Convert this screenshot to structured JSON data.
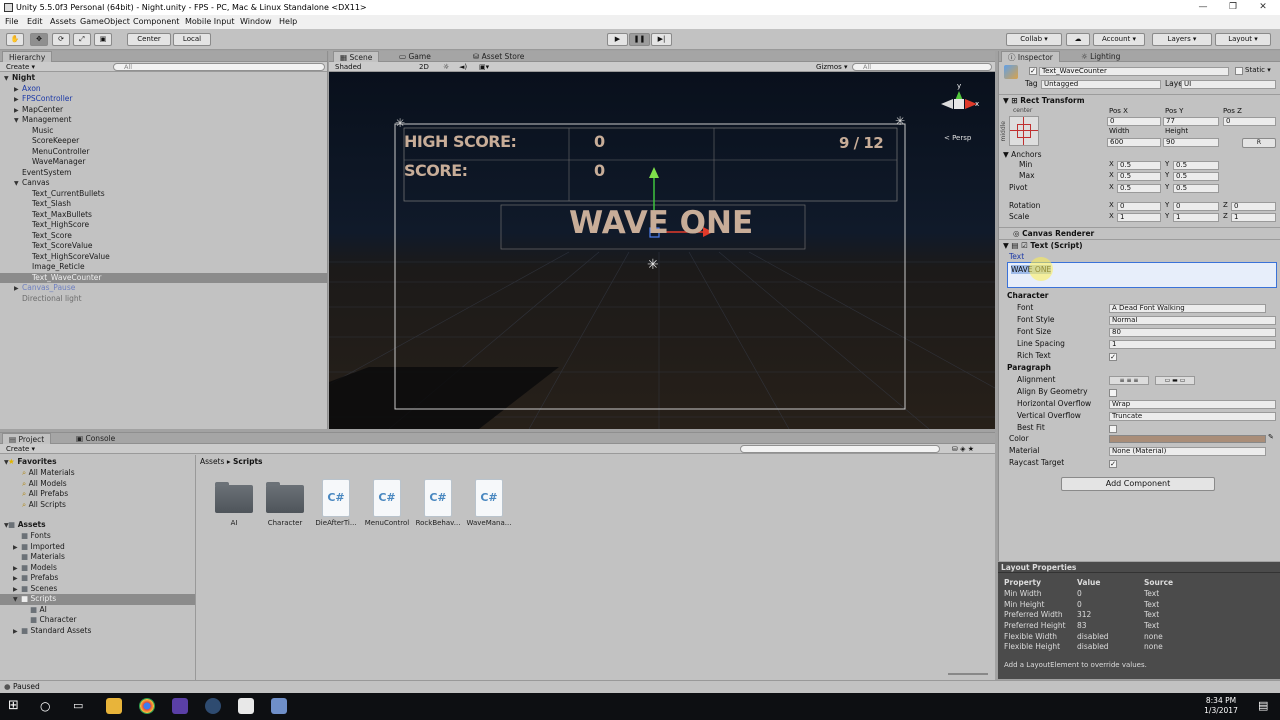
{
  "window": {
    "title": "Unity 5.5.0f3 Personal (64bit) - Night.unity - FPS - PC, Mac & Linux Standalone <DX11>"
  },
  "menu": [
    "File",
    "Edit",
    "Assets",
    "GameObject",
    "Component",
    "Mobile Input",
    "Window",
    "Help"
  ],
  "toolbar": {
    "center": "Center",
    "local": "Local",
    "collab": "Collab ▾",
    "account": "Account ▾",
    "layers": "Layers ▾",
    "layout": "Layout ▾"
  },
  "hierarchy": {
    "tab": "Hierarchy",
    "create": "Create ▾",
    "search_placeholder": "All",
    "items": [
      {
        "label": "Night",
        "indent": 0,
        "arrow": "▼",
        "style": "bold"
      },
      {
        "label": "Axon",
        "indent": 1,
        "arrow": "▶",
        "style": "blue"
      },
      {
        "label": "FPSController",
        "indent": 1,
        "arrow": "▶",
        "style": "blue"
      },
      {
        "label": "MapCenter",
        "indent": 1,
        "arrow": "▶",
        "style": "normal"
      },
      {
        "label": "Management",
        "indent": 1,
        "arrow": "▼",
        "style": "normal"
      },
      {
        "label": "Music",
        "indent": 2,
        "arrow": "",
        "style": "normal"
      },
      {
        "label": "ScoreKeeper",
        "indent": 2,
        "arrow": "",
        "style": "normal"
      },
      {
        "label": "MenuController",
        "indent": 2,
        "arrow": "",
        "style": "normal"
      },
      {
        "label": "WaveManager",
        "indent": 2,
        "arrow": "",
        "style": "normal"
      },
      {
        "label": "EventSystem",
        "indent": 1,
        "arrow": "",
        "style": "normal"
      },
      {
        "label": "Canvas",
        "indent": 1,
        "arrow": "▼",
        "style": "normal"
      },
      {
        "label": "Text_CurrentBullets",
        "indent": 2,
        "arrow": "",
        "style": "normal"
      },
      {
        "label": "Text_Slash",
        "indent": 2,
        "arrow": "",
        "style": "normal"
      },
      {
        "label": "Text_MaxBullets",
        "indent": 2,
        "arrow": "",
        "style": "normal"
      },
      {
        "label": "Text_HighScore",
        "indent": 2,
        "arrow": "",
        "style": "normal"
      },
      {
        "label": "Text_Score",
        "indent": 2,
        "arrow": "",
        "style": "normal"
      },
      {
        "label": "Text_ScoreValue",
        "indent": 2,
        "arrow": "",
        "style": "normal"
      },
      {
        "label": "Text_HighScoreValue",
        "indent": 2,
        "arrow": "",
        "style": "normal"
      },
      {
        "label": "Image_Reticle",
        "indent": 2,
        "arrow": "",
        "style": "normal"
      },
      {
        "label": "Text_WaveCounter",
        "indent": 2,
        "arrow": "",
        "style": "selected"
      },
      {
        "label": "Canvas_Pause",
        "indent": 1,
        "arrow": "▶",
        "style": "blue-gray"
      },
      {
        "label": "Directional light",
        "indent": 1,
        "arrow": "",
        "style": "gray"
      }
    ]
  },
  "scene_tabs": [
    "Scene",
    "Game",
    "Asset Store"
  ],
  "scene_bar": {
    "shaded": "Shaded",
    "mode2d": "2D",
    "gizmos": "Gizmos ▾",
    "search_placeholder": "All",
    "persp": "< Persp"
  },
  "hud": {
    "high_score_label": "HIGH SCORE:",
    "high_score_value": "0",
    "score_label": "SCORE:",
    "score_value": "0",
    "ammo": "9  /  12",
    "wave": "WAVE ONE"
  },
  "inspector": {
    "tabs": [
      "Inspector",
      "Lighting"
    ],
    "object_name": "Text_WaveCounter",
    "static_label": "Static ▾",
    "tag_label": "Tag",
    "tag_value": "Untagged",
    "layer_label": "Layer",
    "layer_value": "UI",
    "rect_transform": {
      "title": "Rect Transform",
      "anchor_preset": "center",
      "anchor_side": "middle",
      "pos_x_label": "Pos X",
      "pos_y_label": "Pos Y",
      "pos_z_label": "Pos Z",
      "pos_x": "0",
      "pos_y": "77",
      "pos_z": "0",
      "width_label": "Width",
      "height_label": "Height",
      "width": "600",
      "height": "90",
      "anchors_label": "Anchors",
      "min_label": "Min",
      "max_label": "Max",
      "pivot_label": "Pivot",
      "min_x": "0.5",
      "min_y": "0.5",
      "max_x": "0.5",
      "max_y": "0.5",
      "pivot_x": "0.5",
      "pivot_y": "0.5",
      "rotation_label": "Rotation",
      "rot_x": "0",
      "rot_y": "0",
      "rot_z": "0",
      "scale_label": "Scale",
      "scale_x": "1",
      "scale_y": "1",
      "scale_z": "1",
      "x": "X",
      "y": "Y",
      "z": "Z",
      "r_button": "R"
    },
    "canvas_renderer": "Canvas Renderer",
    "text_script": {
      "title": "Text (Script)",
      "text_label": "Text",
      "text_value": "WAVE ONE",
      "character": "Character",
      "font_label": "Font",
      "font_value": "Dead Font Walking",
      "font_style_label": "Font Style",
      "font_style_value": "Normal",
      "font_size_label": "Font Size",
      "font_size_value": "80",
      "line_spacing_label": "Line Spacing",
      "line_spacing_value": "1",
      "rich_text_label": "Rich Text",
      "paragraph": "Paragraph",
      "alignment_label": "Alignment",
      "align_geometry_label": "Align By Geometry",
      "h_overflow_label": "Horizontal Overflow",
      "h_overflow_value": "Wrap",
      "v_overflow_label": "Vertical Overflow",
      "v_overflow_value": "Truncate",
      "best_fit_label": "Best Fit",
      "color_label": "Color",
      "color_value": "#a98d78",
      "material_label": "Material",
      "material_value": "None (Material)",
      "raycast_label": "Raycast Target"
    },
    "add_component": "Add Component"
  },
  "layout_properties": {
    "title": "Layout Properties",
    "headers": [
      "Property",
      "Value",
      "Source"
    ],
    "rows": [
      [
        "Min Width",
        "0",
        "Text"
      ],
      [
        "Min Height",
        "0",
        "Text"
      ],
      [
        "Preferred Width",
        "312",
        "Text"
      ],
      [
        "Preferred Height",
        "83",
        "Text"
      ],
      [
        "Flexible Width",
        "disabled",
        "none"
      ],
      [
        "Flexible Height",
        "disabled",
        "none"
      ]
    ],
    "note": "Add a LayoutElement to override values."
  },
  "project": {
    "tabs": [
      "Project",
      "Console"
    ],
    "create": "Create ▾",
    "favorites_title": "Favorites",
    "favorites": [
      "All Materials",
      "All Models",
      "All Prefabs",
      "All Scripts"
    ],
    "assets_title": "Assets",
    "tree": [
      {
        "label": "Fonts",
        "indent": 1,
        "arrow": ""
      },
      {
        "label": "Imported",
        "indent": 1,
        "arrow": "▶"
      },
      {
        "label": "Materials",
        "indent": 1,
        "arrow": ""
      },
      {
        "label": "Models",
        "indent": 1,
        "arrow": "▶"
      },
      {
        "label": "Prefabs",
        "indent": 1,
        "arrow": "▶"
      },
      {
        "label": "Scenes",
        "indent": 1,
        "arrow": "▶"
      },
      {
        "label": "Scripts",
        "indent": 1,
        "arrow": "▼",
        "selected": true
      },
      {
        "label": "AI",
        "indent": 2,
        "arrow": ""
      },
      {
        "label": "Character",
        "indent": 2,
        "arrow": ""
      },
      {
        "label": "Standard Assets",
        "indent": 1,
        "arrow": "▶"
      }
    ],
    "breadcrumb_root": "Assets",
    "breadcrumb_sep": "▸",
    "breadcrumb_current": "Scripts",
    "assets": [
      {
        "label": "AI",
        "kind": "folder"
      },
      {
        "label": "Character",
        "kind": "folder"
      },
      {
        "label": "DieAfterTi...",
        "kind": "script"
      },
      {
        "label": "MenuControl",
        "kind": "script"
      },
      {
        "label": "RockBehav...",
        "kind": "script"
      },
      {
        "label": "WaveMana...",
        "kind": "script"
      }
    ],
    "script_glyph": "C#"
  },
  "status": "Paused",
  "taskbar": {
    "time": "8:34 PM",
    "date": "1/3/2017"
  },
  "colors": {
    "accent_blue": "#3a72d8",
    "selection": "#8b8b8b",
    "hud_text": "#c8ad98"
  }
}
